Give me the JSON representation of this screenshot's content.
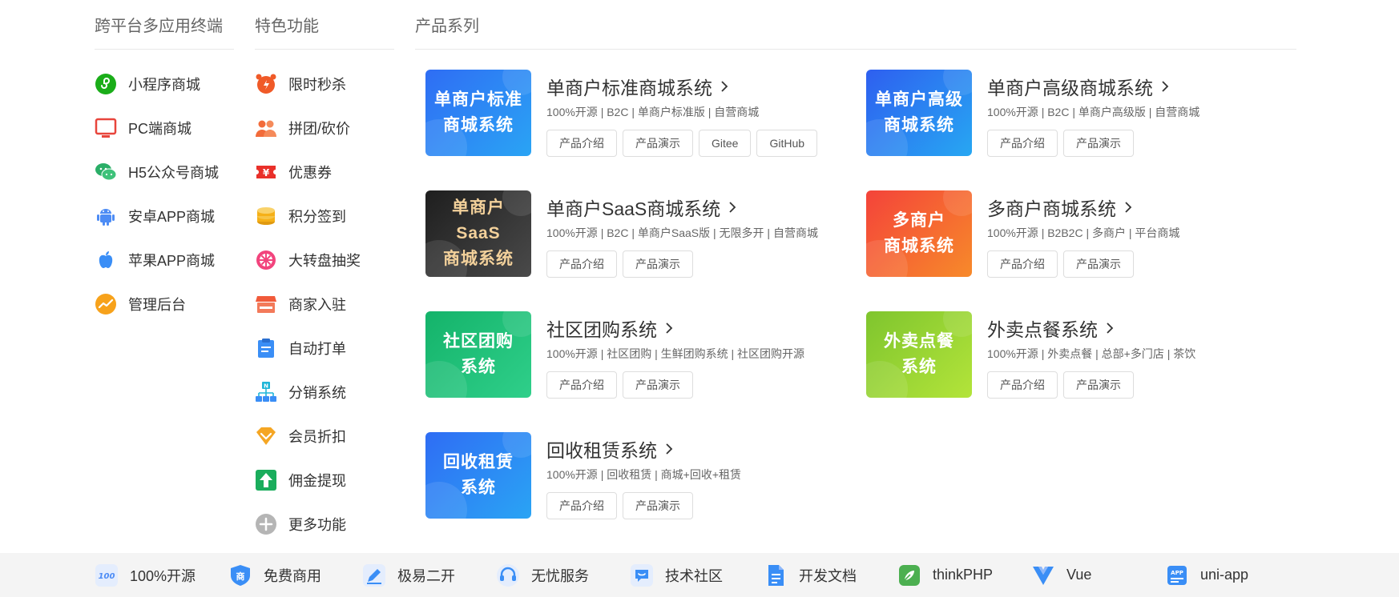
{
  "columns": {
    "platforms": {
      "title": "跨平台多应用终端",
      "items": [
        {
          "label": "小程序商城",
          "icon": "mini-program-icon",
          "color": "#1aad19"
        },
        {
          "label": "PC端商城",
          "icon": "monitor-icon",
          "color": "#e8453c"
        },
        {
          "label": "H5公众号商城",
          "icon": "wechat-icon",
          "color": "#2aae67"
        },
        {
          "label": "安卓APP商城",
          "icon": "android-icon",
          "color": "#4d8cf5"
        },
        {
          "label": "苹果APP商城",
          "icon": "apple-icon",
          "color": "#3a8ef6"
        },
        {
          "label": "管理后台",
          "icon": "dashboard-icon",
          "color": "#f7a21b"
        }
      ]
    },
    "features": {
      "title": "特色功能",
      "items": [
        {
          "label": "限时秒杀",
          "icon": "alarm-clock-icon",
          "color": "#f05a28"
        },
        {
          "label": "拼团/砍价",
          "icon": "group-icon",
          "color": "#f26b3a"
        },
        {
          "label": "优惠券",
          "icon": "coupon-icon",
          "color": "#e9302a"
        },
        {
          "label": "积分签到",
          "icon": "coins-icon",
          "color": "#f5b017"
        },
        {
          "label": "大转盘抽奖",
          "icon": "wheel-icon",
          "color": "#f2447d"
        },
        {
          "label": "商家入驻",
          "icon": "store-icon",
          "color": "#f15a3a"
        },
        {
          "label": "自动打单",
          "icon": "clipboard-icon",
          "color": "#3a8ef6"
        },
        {
          "label": "分销系统",
          "icon": "network-icon",
          "color": "#1fb6d8"
        },
        {
          "label": "会员折扣",
          "icon": "diamond-icon",
          "color": "#f5a623"
        },
        {
          "label": "佣金提现",
          "icon": "upload-arrow-icon",
          "color": "#1aad5c"
        },
        {
          "label": "更多功能",
          "icon": "plus-circle-icon",
          "color": "#b5b5b5"
        }
      ]
    },
    "products": {
      "title": "产品系列",
      "items": [
        {
          "thumb_line1": "单商户标准",
          "thumb_line2": "商城系统",
          "title": "单商户标准商城系统",
          "desc": "100%开源 | B2C | 单商户标准版 | 自营商城",
          "buttons": [
            "产品介绍",
            "产品演示",
            "Gitee",
            "GitHub"
          ],
          "gradient": [
            "#2f6df4",
            "#2aa4f4"
          ]
        },
        {
          "thumb_line1": "单商户高级",
          "thumb_line2": "商城系统",
          "title": "单商户高级商城系统",
          "desc": "100%开源 | B2C | 单商户高级版 | 自营商城",
          "buttons": [
            "产品介绍",
            "产品演示"
          ],
          "gradient": [
            "#2e5ff0",
            "#27a7f2"
          ]
        },
        {
          "thumb_line1": "单商户SaaS",
          "thumb_line2": "商城系统",
          "title": "单商户SaaS商城系统",
          "desc": "100%开源 | B2C | 单商户SaaS版 | 无限多开 | 自营商城",
          "buttons": [
            "产品介绍",
            "产品演示"
          ],
          "gradient": [
            "#1e1e1e",
            "#4a4a4a"
          ],
          "text_color": "#f3d19b"
        },
        {
          "thumb_line1": "多商户",
          "thumb_line2": "商城系统",
          "title": "多商户商城系统",
          "desc": "100%开源 | B2B2C | 多商户 | 平台商城",
          "buttons": [
            "产品介绍",
            "产品演示"
          ],
          "gradient": [
            "#f4433a",
            "#f78a2a"
          ]
        },
        {
          "thumb_line1": "社区团购",
          "thumb_line2": "系统",
          "title": "社区团购系统",
          "desc": "100%开源 | 社区团购 | 生鲜团购系统 | 社区团购开源",
          "buttons": [
            "产品介绍",
            "产品演示"
          ],
          "gradient": [
            "#14b36a",
            "#2fcf8a"
          ]
        },
        {
          "thumb_line1": "外卖点餐",
          "thumb_line2": "系统",
          "title": "外卖点餐系统",
          "desc": "100%开源 | 外卖点餐 | 总部+多门店 | 茶饮",
          "buttons": [
            "产品介绍",
            "产品演示"
          ],
          "gradient": [
            "#7fc52e",
            "#b3e43a"
          ]
        },
        {
          "thumb_line1": "回收租赁",
          "thumb_line2": "系统",
          "title": "回收租赁系统",
          "desc": "100%开源 | 回收租赁 | 商城+回收+租赁",
          "buttons": [
            "产品介绍",
            "产品演示"
          ],
          "gradient": [
            "#2f6df4",
            "#2aa4f4"
          ]
        }
      ]
    }
  },
  "footer": {
    "items": [
      {
        "label": "100%开源",
        "icon": "open-source-icon",
        "color": "#4d8cf5"
      },
      {
        "label": "免费商用",
        "icon": "shield-icon",
        "color": "#3a8ef6"
      },
      {
        "label": "极易二开",
        "icon": "pen-icon",
        "color": "#3a8ef6"
      },
      {
        "label": "无忧服务",
        "icon": "headset-icon",
        "color": "#3a8ef6"
      },
      {
        "label": "技术社区",
        "icon": "chat-icon",
        "color": "#3a8ef6"
      },
      {
        "label": "开发文档",
        "icon": "document-icon",
        "color": "#3a8ef6"
      },
      {
        "label": "thinkPHP",
        "icon": "thinkphp-icon",
        "color": "#4caf50"
      },
      {
        "label": "Vue",
        "icon": "vue-icon",
        "color": "#3a8ef6"
      },
      {
        "label": "uni-app",
        "icon": "app-icon",
        "color": "#3a8ef6"
      }
    ]
  }
}
